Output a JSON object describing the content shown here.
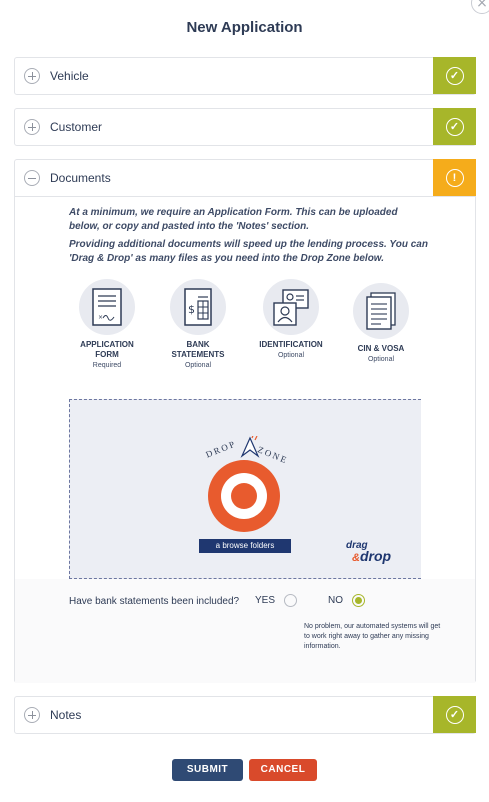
{
  "modal": {
    "title": "New Application",
    "close_glyph": "×"
  },
  "sections": [
    {
      "label": "Vehicle",
      "status": "complete",
      "status_glyph": "✓"
    },
    {
      "label": "Customer",
      "status": "complete",
      "status_glyph": "✓"
    },
    {
      "label": "Documents",
      "status": "warning",
      "status_glyph": "!"
    },
    {
      "label": "Notes",
      "status": "complete",
      "status_glyph": "✓"
    }
  ],
  "documents": {
    "intro_1": "At a minimum, we require an Application Form. This can be uploaded below, or copy and pasted into the 'Notes' section.",
    "intro_2": "Providing additional documents will speed up the lending process. You can 'Drag & Drop' as many files as you need into the Drop Zone below.",
    "types": [
      {
        "label_1": "APPLICATION",
        "label_2": "FORM",
        "sub": "Required",
        "icon": "application-form-icon"
      },
      {
        "label_1": "BANK",
        "label_2": "STATEMENTS",
        "sub": "Optional",
        "icon": "bank-statements-icon"
      },
      {
        "label_1": "IDENTIFICATION",
        "label_2": "",
        "sub": "Optional",
        "icon": "identification-icon"
      },
      {
        "label_1": "CIN & VOSA",
        "label_2": "",
        "sub": "Optional",
        "icon": "cin-vosa-icon"
      }
    ],
    "dropzone": {
      "title_left": "DROP",
      "title_right": "ZONE",
      "browse_label": "a browse folders",
      "logo_line1": "drag",
      "logo_amp": "&",
      "logo_line2": "drop"
    },
    "question": {
      "text": "Have bank statements been included?",
      "yes_label": "YES",
      "no_label": "NO",
      "selected": "NO",
      "note": "No problem, our automated systems will get to work right away to gather any missing information."
    }
  },
  "actions": {
    "submit_label": "SUBMIT",
    "cancel_label": "CANCEL"
  },
  "colors": {
    "complete": "#a7b62a",
    "warning": "#f5ac1b",
    "submit": "#2f4a74",
    "cancel": "#d94a2b",
    "target": "#e85b2e"
  }
}
